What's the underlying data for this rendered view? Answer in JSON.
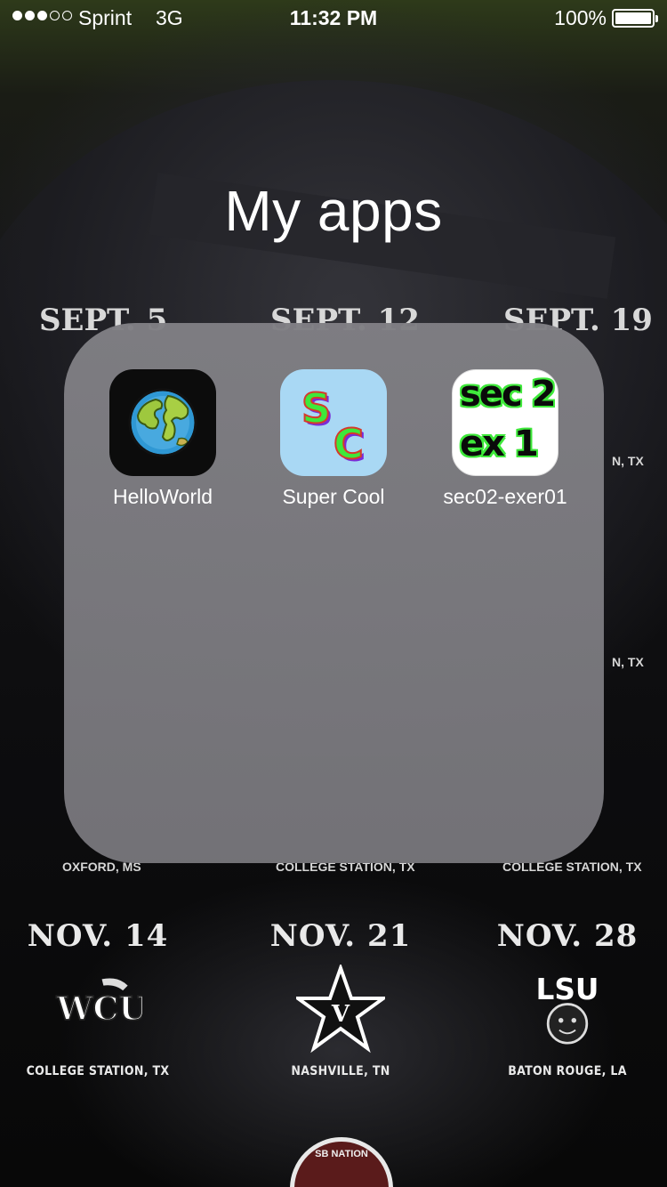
{
  "status_bar": {
    "carrier": "Sprint",
    "network": "3G",
    "time": "11:32 PM",
    "battery_percent": "100%",
    "signal_bars_filled": 3,
    "signal_bars_total": 5
  },
  "folder": {
    "title": "My apps",
    "apps": [
      {
        "label": "HelloWorld",
        "icon": "globe-icon"
      },
      {
        "label": "Super Cool",
        "icon": "sc-letters-icon",
        "icon_text": [
          "S",
          "C"
        ]
      },
      {
        "label": "sec02-exer01",
        "icon": "sec2-ex1-icon",
        "icon_text": [
          "sec 2",
          "ex 1"
        ]
      }
    ]
  },
  "wallpaper": {
    "dates": [
      "SEPT. 5",
      "SEPT. 12",
      "SEPT. 19",
      "NOV. 14",
      "NOV. 21",
      "NOV. 28"
    ],
    "locations": [
      "OXFORD, MS",
      "COLLEGE STATION, TX",
      "COLLEGE STATION, TX",
      "COLLEGE STATION, TX",
      "NASHVILLE, TN",
      "BATON ROUGE, LA"
    ],
    "partial_locations": [
      "N, TX",
      "N, TX"
    ],
    "logo_texts": [
      "LSU"
    ],
    "badge_text": "SB NATION"
  },
  "colors": {
    "folder_bg": "#7f7e84",
    "text": "#ffffff",
    "supercool_bg": "#a9d8f4",
    "sc_green": "#3ee83a",
    "sc_purple": "#7a2bd6"
  }
}
